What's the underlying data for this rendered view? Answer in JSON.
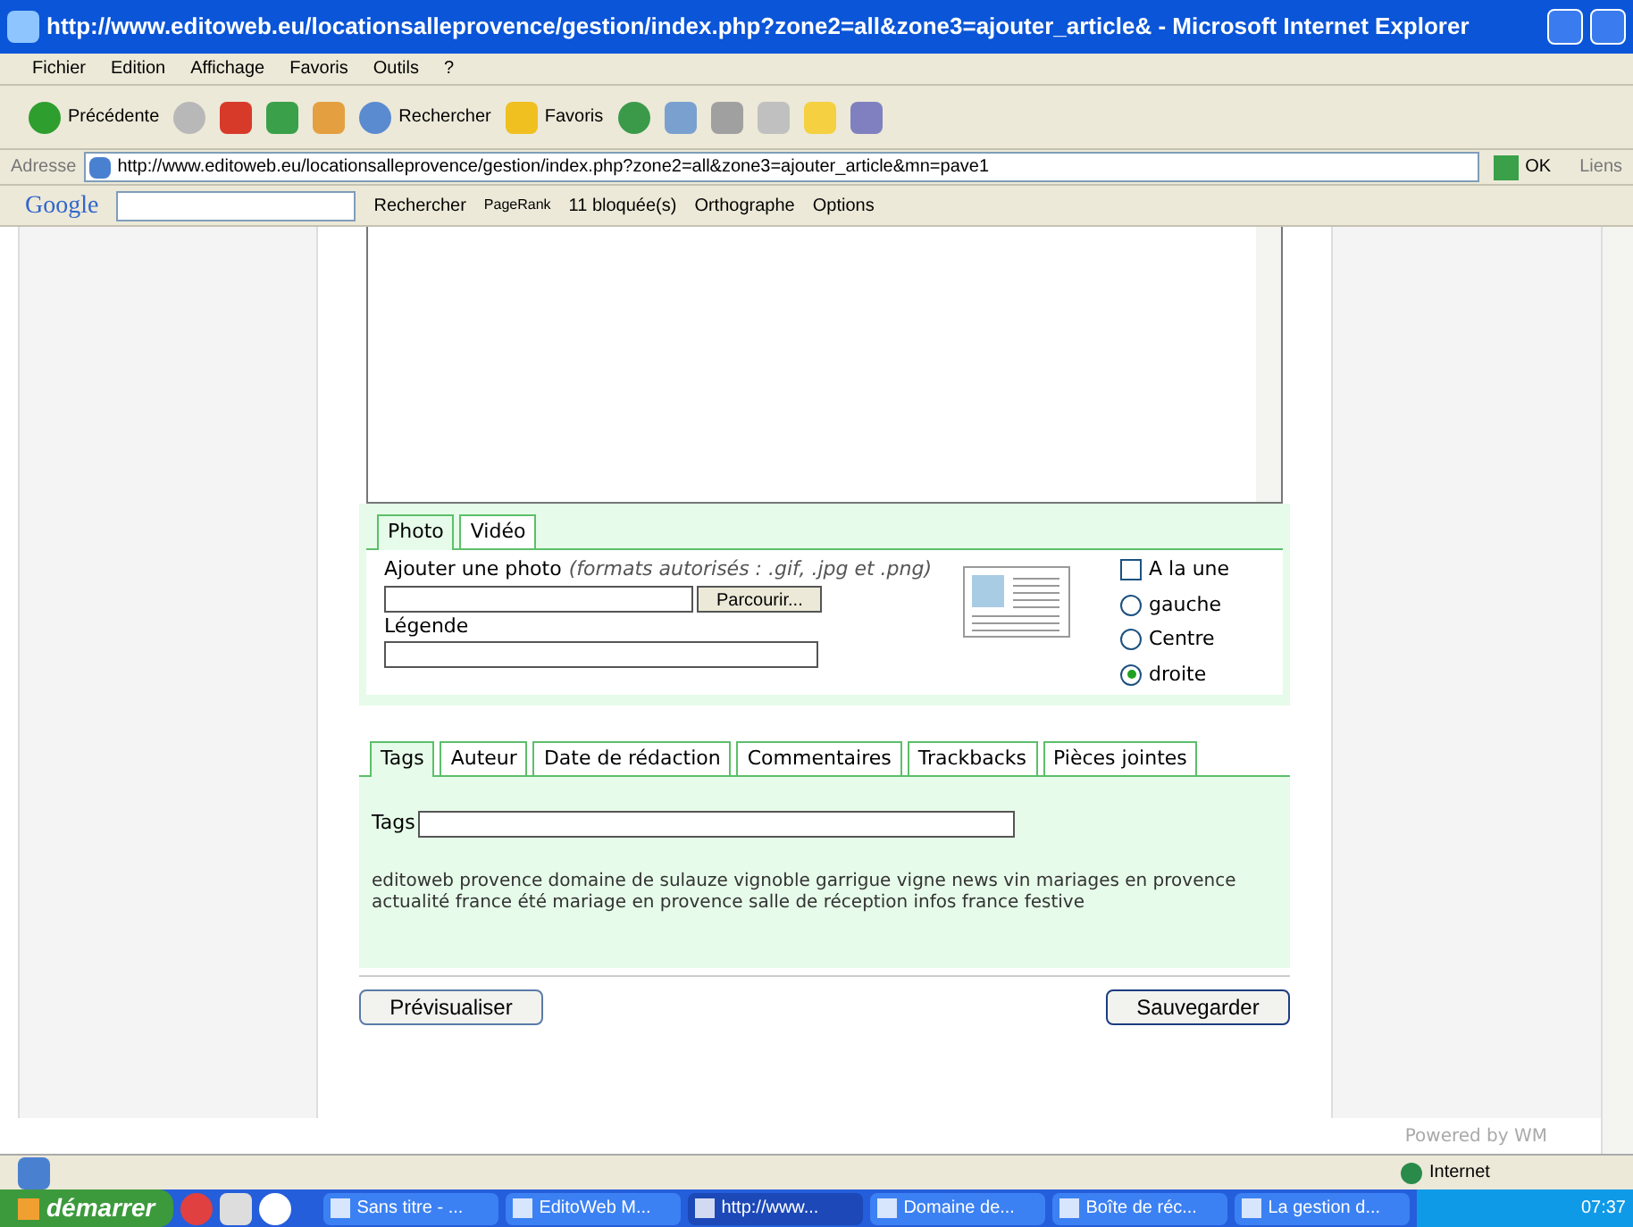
{
  "window": {
    "title": "http://www.editoweb.eu/locationsalleprovence/gestion/index.php?zone2=all&zone3=ajouter_article& - Microsoft Internet Explorer"
  },
  "menu": [
    "Fichier",
    "Edition",
    "Affichage",
    "Favoris",
    "Outils",
    "?"
  ],
  "toolbar": {
    "back": "Précédente",
    "search": "Rechercher",
    "favorites": "Favoris"
  },
  "address": {
    "label": "Adresse",
    "url": "http://www.editoweb.eu/locationsalleprovence/gestion/index.php?zone2=all&zone3=ajouter_article&mn=pave1",
    "go": "OK",
    "links": "Liens"
  },
  "google_bar": {
    "logo": "Google",
    "search": "Rechercher",
    "pagerank": "PageRank",
    "blocked": "11 bloquée(s)",
    "spelling": "Orthographe",
    "options": "Options"
  },
  "media_tabs": [
    {
      "label": "Photo",
      "selected": true
    },
    {
      "label": "Vidéo",
      "selected": false
    }
  ],
  "photo": {
    "label": "Ajouter une photo",
    "hint": "*(formats autorisés : .gif, .jpg et .png)*",
    "browse": "Parcourir...",
    "caption_label": "Légende"
  },
  "placement": {
    "front_page": {
      "label": "A la une",
      "checked": false
    },
    "options": [
      {
        "label": "gauche",
        "selected": false
      },
      {
        "label": "Centre",
        "selected": false
      },
      {
        "label": "droite",
        "selected": true
      }
    ]
  },
  "meta_tabs": [
    {
      "label": "Tags",
      "selected": true
    },
    {
      "label": "Auteur",
      "selected": false
    },
    {
      "label": "Date de rédaction",
      "selected": false
    },
    {
      "label": "Commentaires",
      "selected": false
    },
    {
      "label": "Trackbacks",
      "selected": false
    },
    {
      "label": "Pièces jointes",
      "selected": false
    }
  ],
  "tags": {
    "label": "Tags",
    "suggestions": "editoweb provence domaine de sulauze vignoble garrigue vigne news vin mariages en provence actualité france été mariage en provence salle de réception infos france festive"
  },
  "buttons": {
    "preview": "Prévisualiser",
    "save": "Sauvegarder"
  },
  "footer": "Powered by WM",
  "status_bar": {
    "zone": "Internet"
  },
  "taskbar": {
    "start": "démarrer",
    "tasks": [
      {
        "label": "Sans titre - ...",
        "selected": false
      },
      {
        "label": "EditoWeb M...",
        "selected": false
      },
      {
        "label": "http://www...",
        "selected": true
      },
      {
        "label": "Domaine de...",
        "selected": false
      },
      {
        "label": "Boîte de réc...",
        "selected": false
      },
      {
        "label": "La gestion d...",
        "selected": false
      }
    ],
    "clock": "07:37"
  }
}
